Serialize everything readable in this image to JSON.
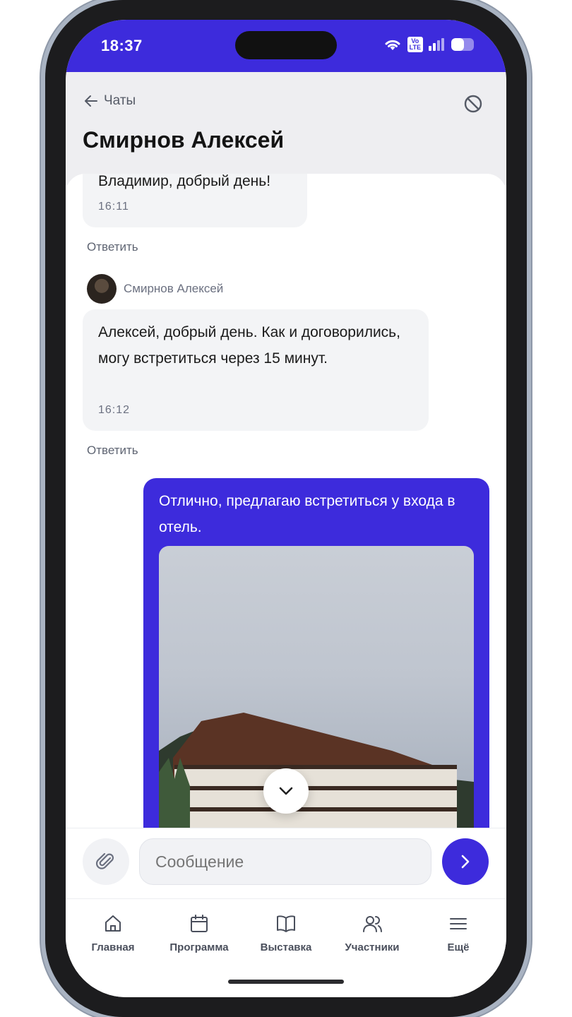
{
  "status_bar": {
    "time": "18:37",
    "volte_top": "Vo",
    "volte_bottom": "LTE",
    "battery_level": 0.55
  },
  "header": {
    "back_label": "Чаты",
    "title": "Смирнов Алексей"
  },
  "messages": [
    {
      "text": "Владимир, добрый день!",
      "time": "16:11",
      "reply": "Ответить"
    },
    {
      "sender": "Смирнов Алексей",
      "text": "Алексей, добрый день. Как и договорились, могу встретиться через 15 минут.",
      "time": "16:12",
      "reply": "Ответить"
    },
    {
      "text": "Отлично, предлагаю встретиться у входа в отель."
    }
  ],
  "composer": {
    "placeholder": "Сообщение"
  },
  "tabs": [
    {
      "label": "Главная",
      "icon": "home-icon"
    },
    {
      "label": "Программа",
      "icon": "calendar-icon"
    },
    {
      "label": "Выставка",
      "icon": "book-icon"
    },
    {
      "label": "Участники",
      "icon": "users-icon"
    },
    {
      "label": "Ещё",
      "icon": "menu-icon"
    }
  ],
  "colors": {
    "accent": "#3d2bdc",
    "bubble_in": "#f3f4f6",
    "header_bg": "#eeeef1"
  }
}
